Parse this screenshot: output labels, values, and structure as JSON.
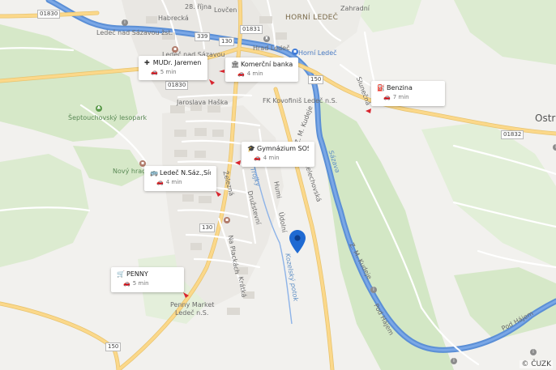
{
  "map": {
    "copyright": "© ČUZK",
    "districts": [
      {
        "id": "horni-ledec",
        "text": "HORNÍ LEDEČ"
      },
      {
        "id": "ostr",
        "text": "Ostr"
      }
    ],
    "street_labels": [
      {
        "id": "habrecka",
        "text": "Habrecká"
      },
      {
        "id": "28-rijna",
        "text": "28. října"
      },
      {
        "id": "lovcen",
        "text": "Lovčen"
      },
      {
        "id": "zahradni",
        "text": "Zahradní"
      },
      {
        "id": "ledec-nad-sazavou-zst",
        "text": "Ledeč nad Sázavou žst."
      },
      {
        "id": "ledec-nad-sazavou-2",
        "text": "Ledeč nad Sázavou"
      },
      {
        "id": "hrad-ledec",
        "text": "Hrad Ledeč"
      },
      {
        "id": "horni-ledec-stop",
        "text": "Horní Ledeč"
      },
      {
        "id": "jaroslava-haska",
        "text": "Jaroslava Haška"
      },
      {
        "id": "fk-kovofinis",
        "text": "FK Kovofiniš Ledeč n.S."
      },
      {
        "id": "slunecna",
        "text": "Slunečná"
      },
      {
        "id": "z-m-kudeje",
        "text": "Z. M. Kudeje"
      },
      {
        "id": "zelezna",
        "text": "Železná"
      },
      {
        "id": "druzstevni",
        "text": "Družstevní"
      },
      {
        "id": "humi",
        "text": "Humi"
      },
      {
        "id": "melechovska",
        "text": "Melechovská"
      },
      {
        "id": "udolni",
        "text": "Údolní"
      },
      {
        "id": "na-plackach",
        "text": "Na Plackách"
      },
      {
        "id": "kratka",
        "text": "Krátká"
      },
      {
        "id": "z-m-kudeje-2",
        "text": "Z. M. Kudeje"
      },
      {
        "id": "pod-hajem",
        "text": "Pod Hájem"
      },
      {
        "id": "pod-hajem-2",
        "text": "Pod Hájem"
      },
      {
        "id": "penny-market",
        "text": "Penny Market"
      },
      {
        "id": "penny-market-2",
        "text": "Ledeč n.S."
      },
      {
        "id": "novy-hrad",
        "text": "Nový hrad"
      }
    ],
    "water_labels": [
      {
        "id": "sazava",
        "text": "Sázava"
      },
      {
        "id": "kozelsky-potok",
        "text": "Kozelský potok"
      },
      {
        "id": "trojky",
        "text": "Trojky"
      }
    ],
    "park_labels": [
      {
        "id": "septouchovsky-lesopark",
        "text": "Šeptouchovský lesopark"
      }
    ],
    "road_shields": [
      {
        "id": "r01830a",
        "text": "01830"
      },
      {
        "id": "r339",
        "text": "339"
      },
      {
        "id": "r130a",
        "text": "130"
      },
      {
        "id": "r01831",
        "text": "01831"
      },
      {
        "id": "r01830b",
        "text": "01830"
      },
      {
        "id": "r150a",
        "text": "150"
      },
      {
        "id": "r01832",
        "text": "01832"
      },
      {
        "id": "r130b",
        "text": "130"
      },
      {
        "id": "r150b",
        "text": "150"
      }
    ]
  },
  "cards": [
    {
      "id": "mudr",
      "icon": "medical-cross-icon",
      "glyph": "✚",
      "name": "MUDr. Jaremenko...",
      "time": "5 min"
    },
    {
      "id": "banka",
      "icon": "bank-icon",
      "glyph": "🏛",
      "name": "Komerční banka",
      "time": "4 min"
    },
    {
      "id": "benzina",
      "icon": "fuel-station-icon",
      "glyph": "⛽",
      "name": "Benzina",
      "time": "7 min"
    },
    {
      "id": "gymnazium",
      "icon": "graduation-cap-icon",
      "glyph": "🎓",
      "name": "Gymnázium SOŠ ...",
      "time": "4 min"
    },
    {
      "id": "zastavka",
      "icon": "bus-icon",
      "glyph": "🚌",
      "name": "Ledeč N.Sáz.,Sídl....",
      "time": "4 min"
    },
    {
      "id": "penny",
      "icon": "shopping-cart-icon",
      "glyph": "🛒",
      "name": "PENNY",
      "time": "5 min"
    }
  ],
  "colors": {
    "background": "#f2f1ee",
    "river": "#5b8fd6",
    "forest": "#d6e8c8",
    "road_major": "#fbd88a",
    "road_minor": "#ffffff",
    "pin": "#1f6ad2",
    "arrow": "#d8262f"
  }
}
